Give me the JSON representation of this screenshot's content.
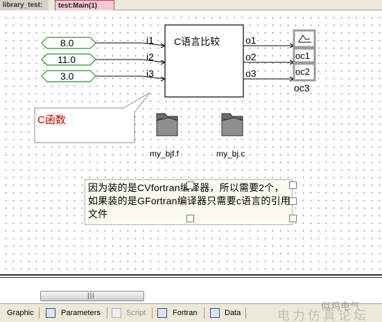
{
  "tabs": {
    "inactive_label": "library_test:",
    "active_label": "test:Main(1)"
  },
  "constants": [
    "8.0",
    "11.0",
    "3.0"
  ],
  "block": {
    "title": "C语言比较",
    "inputs": [
      "i1",
      "i2",
      "i3"
    ],
    "outputs": [
      "o1",
      "o2",
      "o3"
    ]
  },
  "output_meters": [
    "oc1",
    "oc2",
    "oc3"
  ],
  "callout": {
    "text": "C函数"
  },
  "files": [
    {
      "label": "my_bjf.f",
      "icon": "folder-icon"
    },
    {
      "label": "my_bj.c",
      "icon": "folder-icon"
    }
  ],
  "note": {
    "text": "因为装的是CVfortran编译器，所以需要2个，如果装的是GFortran编译器只需要c语言的引用文件"
  },
  "bottom_tabs": [
    {
      "label": "Graphic",
      "enabled": true
    },
    {
      "label": "Parameters",
      "enabled": true
    },
    {
      "label": "Script",
      "enabled": false
    },
    {
      "label": "Fortran",
      "enabled": true
    },
    {
      "label": "Data",
      "enabled": true
    }
  ],
  "watermark": {
    "left": "电力仿真论坛",
    "right": "似鸡电气"
  },
  "colors": {
    "constant_border": "#2e8b2e",
    "callout_text": "#c00000",
    "active_tab": "#f7c9d3"
  }
}
